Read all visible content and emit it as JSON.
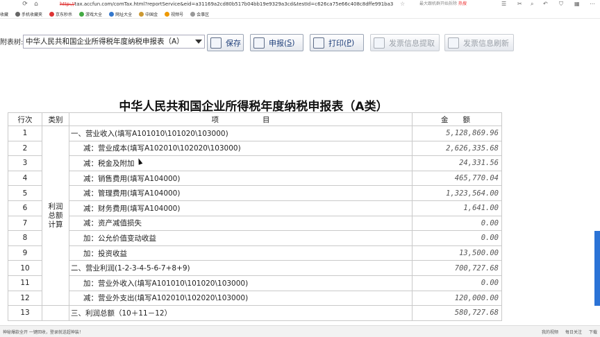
{
  "browser": {
    "url_proto": "http://",
    "url_rest": "tax.accfun.com/comTax.html?reportService&eid=a31169a2cd80b517b04bb19e9329a3cd&testId=c626ca75e66c408c8dffe991ba3",
    "search_text": "最大跟机群开始拆除",
    "search_hot": "热搜",
    "bookmarks": [
      "收藏",
      "手机收藏夹",
      "京东秒杀",
      "游戏大全",
      "网址大全",
      "中国金",
      "视频号",
      "会事区"
    ]
  },
  "toolbar": {
    "label": "附表树:",
    "select_value": "中华人民共和国企业所得税年度纳税申报表（A）",
    "save": "保存",
    "declare": "申报(",
    "declare_key": "S",
    "print": "打印(",
    "print_key": "P",
    "close_paren": ")",
    "invoice_fetch": "发票信息提取",
    "invoice_refresh": "发票信息刷新"
  },
  "report": {
    "title": "中华人民共和国企业所得税年度纳税申报表（A类）",
    "headers": {
      "no": "行次",
      "category": "类别",
      "item": "项　　　　　　目",
      "amount": "金　　额"
    },
    "category_label": "利润总额计算",
    "category_lines": [
      "利润",
      "总额",
      "计算"
    ],
    "rows": [
      {
        "no": "1",
        "item": "一、营业收入(填写A101010\\101020\\103000)",
        "amount": "5,128,869.96"
      },
      {
        "no": "2",
        "item": "减：营业成本(填写A102010\\102020\\103000)",
        "amount": "2,626,335.68"
      },
      {
        "no": "3",
        "item": "减：税金及附加",
        "amount": "24,331.56"
      },
      {
        "no": "4",
        "item": "减：销售费用(填写A104000)",
        "amount": "465,770.04"
      },
      {
        "no": "5",
        "item": "减：管理费用(填写A104000)",
        "amount": "1,323,564.00"
      },
      {
        "no": "6",
        "item": "减：财务费用(填写A104000)",
        "amount": "1,641.00"
      },
      {
        "no": "7",
        "item": "减：资产减值损失",
        "amount": "0.00"
      },
      {
        "no": "8",
        "item": "加：公允价值变动收益",
        "amount": "0.00"
      },
      {
        "no": "9",
        "item": "加：投资收益",
        "amount": "13,500.00"
      },
      {
        "no": "10",
        "item": "二、营业利润(1-2-3-4-5-6-7+8+9)",
        "amount": "700,727.68"
      },
      {
        "no": "11",
        "item": "加：营业外收入(填写A101010\\101020\\103000)",
        "amount": "0.00"
      },
      {
        "no": "12",
        "item": "减：营业外支出(填写A102010\\102020\\103000)",
        "amount": "120,000.00"
      },
      {
        "no": "13",
        "item": "三、利润总额（10＋11－12）",
        "amount": "580,727.68"
      }
    ]
  },
  "statusbar": {
    "left": "神秘爆款全开 一键回收，登录就送超神装！",
    "right": [
      "我的视频",
      "每日关注",
      "下载"
    ]
  }
}
